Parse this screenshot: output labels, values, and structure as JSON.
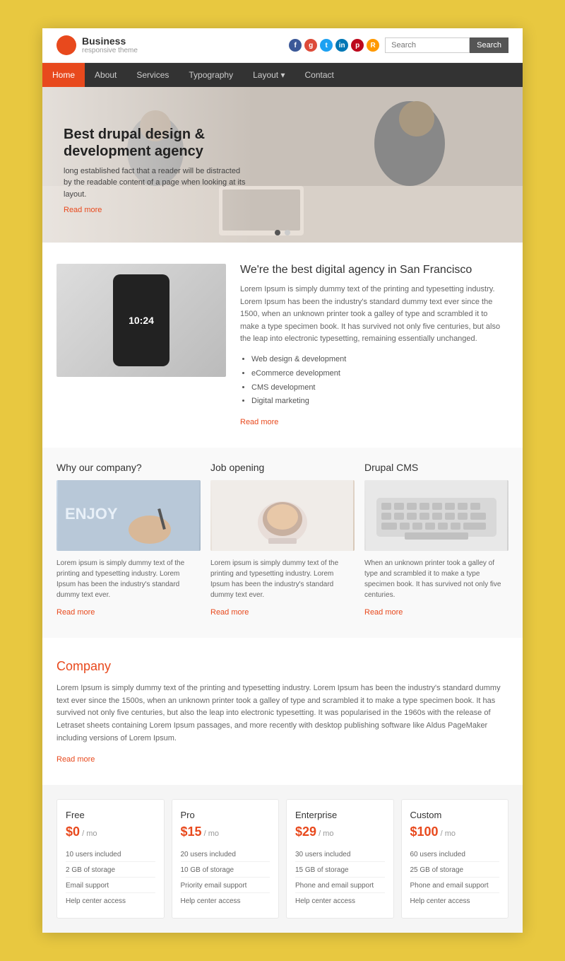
{
  "header": {
    "logo": {
      "main": "Business",
      "sub": "responsive theme"
    },
    "search_placeholder": "Search",
    "search_button": "Search",
    "social_icons": [
      "f",
      "g+",
      "t",
      "in",
      "p",
      "rss"
    ]
  },
  "nav": {
    "items": [
      {
        "label": "Home",
        "active": true
      },
      {
        "label": "About",
        "active": false
      },
      {
        "label": "Services",
        "active": false
      },
      {
        "label": "Typography",
        "active": false
      },
      {
        "label": "Layout",
        "active": false,
        "has_dropdown": true
      },
      {
        "label": "Contact",
        "active": false
      }
    ]
  },
  "hero": {
    "title": "Best drupal design & development agency",
    "description": "long established fact that a reader will be distracted by the readable content of a page when looking at its layout.",
    "readmore": "Read more",
    "slide_count": 2,
    "active_slide": 1
  },
  "about": {
    "image_time": "10:24",
    "heading": "We're the best digital agency in San Francisco",
    "body": "Lorem Ipsum is simply dummy text of the printing and typesetting industry. Lorem Ipsum has been the industry's standard dummy text ever since the 1500, when an unknown printer took a galley of type and scrambled it to make a type specimen book. It has survived not only five centuries, but also the leap into electronic typesetting, remaining essentially unchanged.",
    "list_items": [
      "Web design & development",
      "eCommerce development",
      "CMS development",
      "Digital marketing"
    ],
    "readmore": "Read more"
  },
  "three_columns": [
    {
      "heading": "Why our company?",
      "image_label": "ENJOY",
      "body": "Lorem ipsum is simply dummy text of the printing and typesetting industry. Lorem Ipsum has been the industry's standard dummy text ever.",
      "readmore": "Read more"
    },
    {
      "heading": "Job opening",
      "image_label": "☕",
      "body": "Lorem ipsum is simply dummy text of the printing and typesetting industry. Lorem Ipsum has been the industry's standard dummy text ever.",
      "readmore": "Read more"
    },
    {
      "heading": "Drupal CMS",
      "image_label": "⌨",
      "body": "When an unknown printer took a galley of type and scrambled it to make a type specimen book. It has survived not only five centuries.",
      "readmore": "Read more"
    }
  ],
  "company": {
    "heading": "Company",
    "body": "Lorem Ipsum is simply dummy text of the printing and typesetting industry. Lorem Ipsum has been the industry's standard dummy text ever since the 1500s, when an unknown printer took a galley of type and scrambled it to make a type specimen book. It has survived not only five centuries, but also the leap into electronic typesetting. It was popularised in the 1960s with the release of Letraset sheets containing Lorem Ipsum passages, and more recently with desktop publishing software like Aldus PageMaker including versions of Lorem Ipsum.",
    "readmore": "Read more"
  },
  "pricing": [
    {
      "tier": "Free",
      "price": "$0",
      "period": "/ mo",
      "features": [
        "10 users included",
        "2 GB of storage",
        "Email support",
        "Help center access"
      ]
    },
    {
      "tier": "Pro",
      "price": "$15",
      "period": "/ mo",
      "features": [
        "20 users included",
        "10 GB of storage",
        "Priority email support",
        "Help center access"
      ]
    },
    {
      "tier": "Enterprise",
      "price": "$29",
      "period": "/ mo",
      "features": [
        "30 users included",
        "15 GB of storage",
        "Phone and email support",
        "Help center access"
      ]
    },
    {
      "tier": "Custom",
      "price": "$100",
      "period": "/ mo",
      "features": [
        "60 users included",
        "25 GB of storage",
        "Phone and email support",
        "Help center access"
      ]
    }
  ]
}
